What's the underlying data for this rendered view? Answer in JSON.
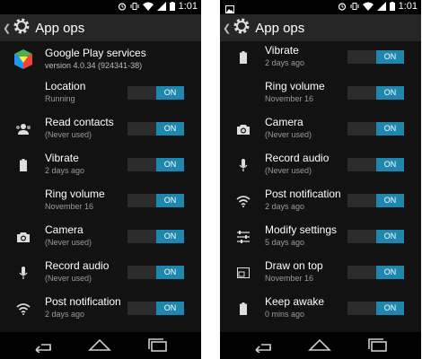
{
  "statusbar": {
    "time": "1:01"
  },
  "actionbar": {
    "title": "App ops"
  },
  "left": {
    "app_name": "Google Play services",
    "app_version": "version 4.0.34 (924341-38)",
    "items": [
      {
        "label": "Location",
        "status": "Running",
        "toggle": "ON",
        "icon": "none"
      },
      {
        "label": "Read contacts",
        "status": "(Never used)",
        "toggle": "ON",
        "icon": "contacts-icon"
      },
      {
        "label": "Vibrate",
        "status": "2 days ago",
        "toggle": "ON",
        "icon": "battery-icon"
      },
      {
        "label": "Ring volume",
        "status": "November 16",
        "toggle": "ON",
        "icon": "none"
      },
      {
        "label": "Camera",
        "status": "(Never used)",
        "toggle": "ON",
        "icon": "camera-icon"
      },
      {
        "label": "Record audio",
        "status": "(Never used)",
        "toggle": "ON",
        "icon": "microphone-icon"
      },
      {
        "label": "Post notification",
        "status": "2 days ago",
        "toggle": "ON",
        "icon": "wifi-icon"
      }
    ]
  },
  "right": {
    "items": [
      {
        "label": "Vibrate",
        "status": "2 days ago",
        "toggle": "ON",
        "icon": "battery-icon"
      },
      {
        "label": "Ring volume",
        "status": "November 16",
        "toggle": "ON",
        "icon": "none"
      },
      {
        "label": "Camera",
        "status": "(Never used)",
        "toggle": "ON",
        "icon": "camera-icon"
      },
      {
        "label": "Record audio",
        "status": "(Never used)",
        "toggle": "ON",
        "icon": "microphone-icon"
      },
      {
        "label": "Post notification",
        "status": "2 days ago",
        "toggle": "ON",
        "icon": "wifi-icon"
      },
      {
        "label": "Modify settings",
        "status": "5 days ago",
        "toggle": "ON",
        "icon": "sliders-icon"
      },
      {
        "label": "Draw on top",
        "status": "November 16",
        "toggle": "ON",
        "icon": "window-icon"
      },
      {
        "label": "Keep awake",
        "status": "0 mins ago",
        "toggle": "ON",
        "icon": "battery-icon"
      }
    ]
  },
  "colors": {
    "accent": "#1f86b0",
    "background": "#121212",
    "actionbar": "#262626"
  }
}
